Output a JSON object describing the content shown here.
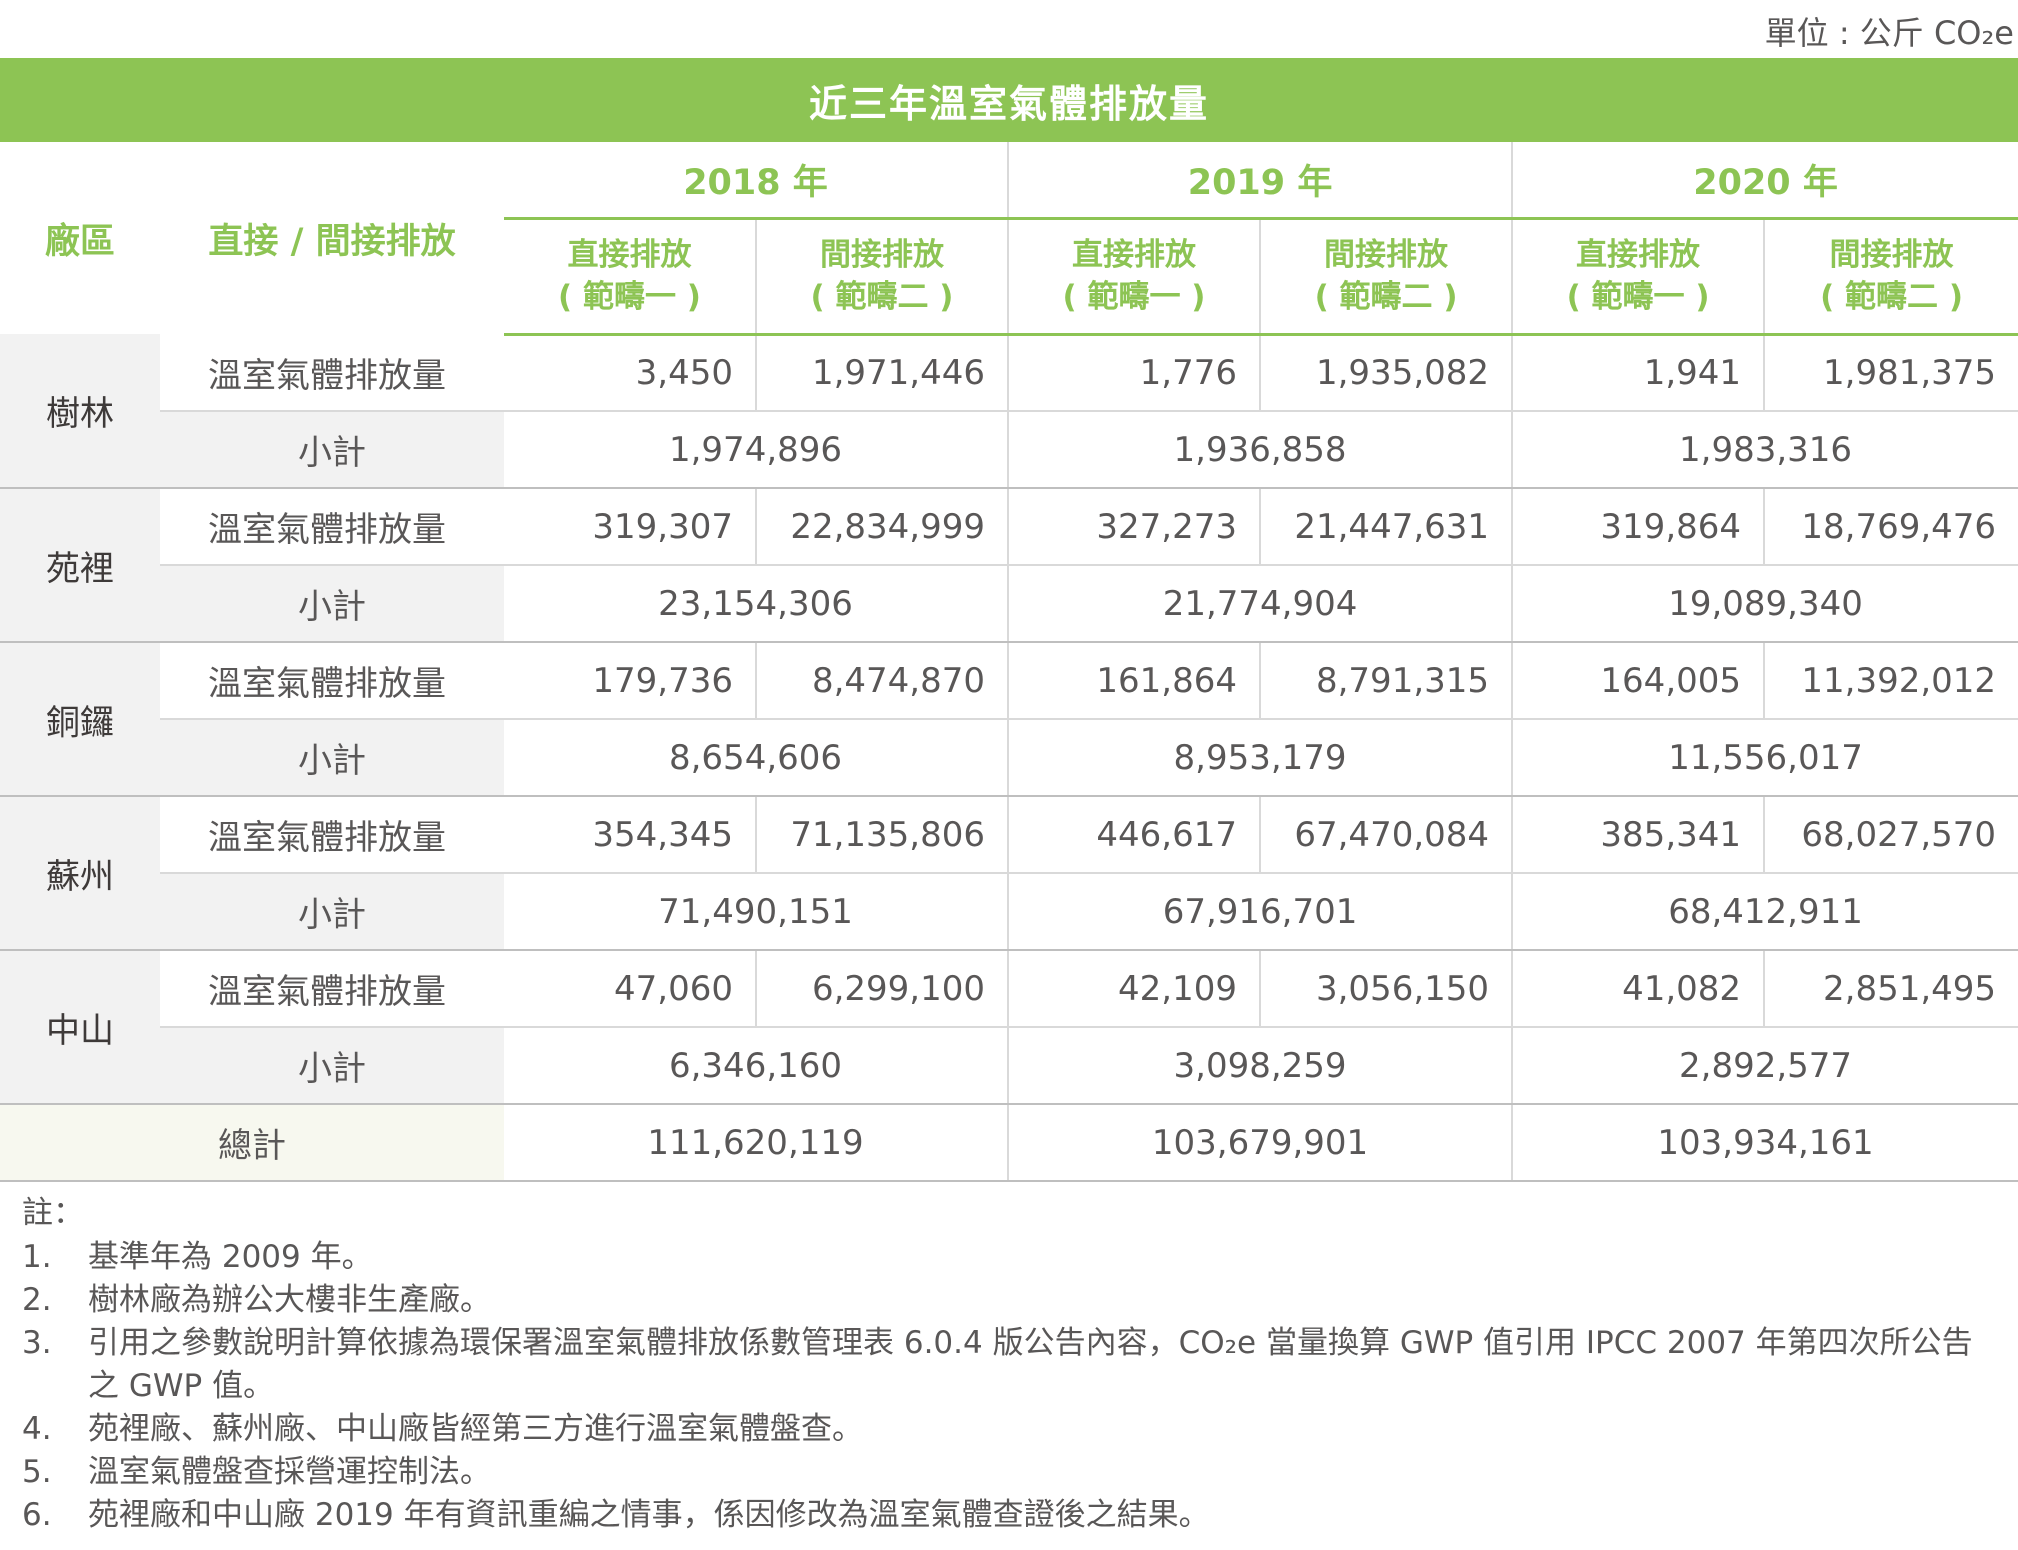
{
  "unit_label": "單位 : 公斤 CO₂e",
  "title": "近三年溫室氣體排放量",
  "header": {
    "site": "廠區",
    "type": "直接 / 間接排放",
    "years": [
      "2018 年",
      "2019 年",
      "2020 年"
    ],
    "direct": "直接排放",
    "direct_scope": "( 範疇一 )",
    "indirect": "間接排放",
    "indirect_scope": "( 範疇二 )"
  },
  "row_labels": {
    "emission": "溫室氣體排放量",
    "subtotal": "小計"
  },
  "sites": [
    {
      "name": "樹林",
      "direct": [
        "3,450",
        "1,776",
        "1,941"
      ],
      "indirect": [
        "1,971,446",
        "1,935,082",
        "1,981,375"
      ],
      "subtotal": [
        "1,974,896",
        "1,936,858",
        "1,983,316"
      ]
    },
    {
      "name": "苑裡",
      "direct": [
        "319,307",
        "327,273",
        "319,864"
      ],
      "indirect": [
        "22,834,999",
        "21,447,631",
        "18,769,476"
      ],
      "subtotal": [
        "23,154,306",
        "21,774,904",
        "19,089,340"
      ]
    },
    {
      "name": "銅鑼",
      "direct": [
        "179,736",
        "161,864",
        "164,005"
      ],
      "indirect": [
        "8,474,870",
        "8,791,315",
        "11,392,012"
      ],
      "subtotal": [
        "8,654,606",
        "8,953,179",
        "11,556,017"
      ]
    },
    {
      "name": "蘇州",
      "direct": [
        "354,345",
        "446,617",
        "385,341"
      ],
      "indirect": [
        "71,135,806",
        "67,470,084",
        "68,027,570"
      ],
      "subtotal": [
        "71,490,151",
        "67,916,701",
        "68,412,911"
      ]
    },
    {
      "name": "中山",
      "direct": [
        "47,060",
        "42,109",
        "41,082"
      ],
      "indirect": [
        "6,299,100",
        "3,056,150",
        "2,851,495"
      ],
      "subtotal": [
        "6,346,160",
        "3,098,259",
        "2,892,577"
      ]
    }
  ],
  "total": {
    "label": "總計",
    "values": [
      "111,620,119",
      "103,679,901",
      "103,934,161"
    ]
  },
  "notes": {
    "title": "註：",
    "items": [
      {
        "n": "1.",
        "text": "基準年為 2009 年。"
      },
      {
        "n": "2.",
        "text": "樹林廠為辦公大樓非生產廠。"
      },
      {
        "n": "3.",
        "text": "引用之參數說明計算依據為環保署溫室氣體排放係數管理表 6.0.4 版公告內容，CO₂e 當量換算 GWP 值引用 IPCC 2007 年第四次所公告之 GWP 值。"
      },
      {
        "n": "4.",
        "text": "苑裡廠、蘇州廠、中山廠皆經第三方進行溫室氣體盤查。"
      },
      {
        "n": "5.",
        "text": "溫室氣體盤查採營運控制法。"
      },
      {
        "n": "6.",
        "text": "苑裡廠和中山廠 2019 年有資訊重編之情事，係因修改為溫室氣體查證後之結果。"
      }
    ]
  },
  "colors": {
    "accent": "#8dc454",
    "text": "#595757",
    "shade": "#f2f2f2",
    "total_shade": "#f7f8ef"
  }
}
